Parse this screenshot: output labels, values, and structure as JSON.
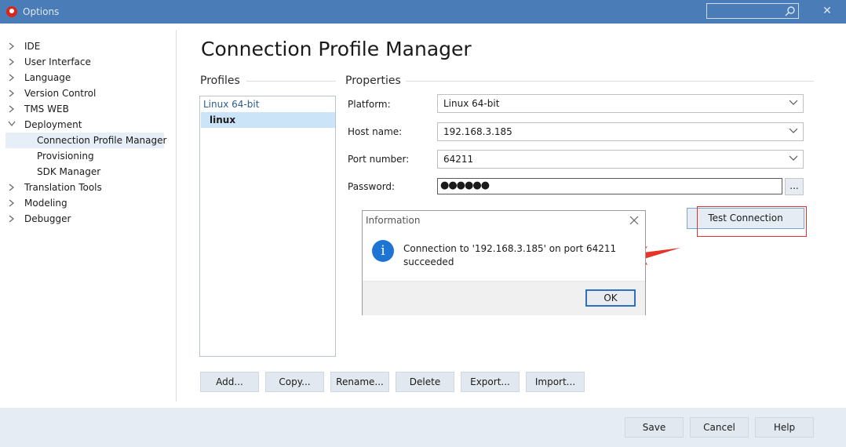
{
  "window": {
    "title": "Options",
    "close_glyph": "✕"
  },
  "tree": {
    "items": [
      {
        "label": "IDE"
      },
      {
        "label": "User Interface"
      },
      {
        "label": "Language"
      },
      {
        "label": "Version Control"
      },
      {
        "label": "TMS WEB"
      },
      {
        "label": "Deployment"
      },
      {
        "label": "Connection Profile Manager"
      },
      {
        "label": "Provisioning"
      },
      {
        "label": "SDK Manager"
      },
      {
        "label": "Translation Tools"
      },
      {
        "label": "Modeling"
      },
      {
        "label": "Debugger"
      }
    ]
  },
  "page": {
    "title": "Connection Profile Manager"
  },
  "profiles": {
    "heading": "Profiles",
    "platform_group": "Linux 64-bit",
    "selected_profile": "linux"
  },
  "properties": {
    "heading": "Properties",
    "platform_label": "Platform:",
    "platform_value": "Linux 64-bit",
    "host_label": "Host name:",
    "host_value": "192.168.3.185",
    "port_label": "Port number:",
    "port_value": "64211",
    "password_label": "Password:",
    "password_mask": "●●●●●●",
    "browse_label": "...",
    "test_button": "Test Connection"
  },
  "dialog": {
    "title": "Information",
    "icon": "i",
    "message": "Connection to '192.168.3.185' on port 64211 succeeded",
    "ok_button": "OK"
  },
  "profile_buttons": {
    "add": "Add...",
    "copy": "Copy...",
    "rename": "Rename...",
    "delete": "Delete",
    "export": "Export...",
    "import": "Import..."
  },
  "footer": {
    "save": "Save",
    "cancel": "Cancel",
    "help": "Help"
  },
  "colors": {
    "titlebar": "#4a7cb8",
    "accent": "#1d74d2",
    "annotation": "#e03030"
  }
}
